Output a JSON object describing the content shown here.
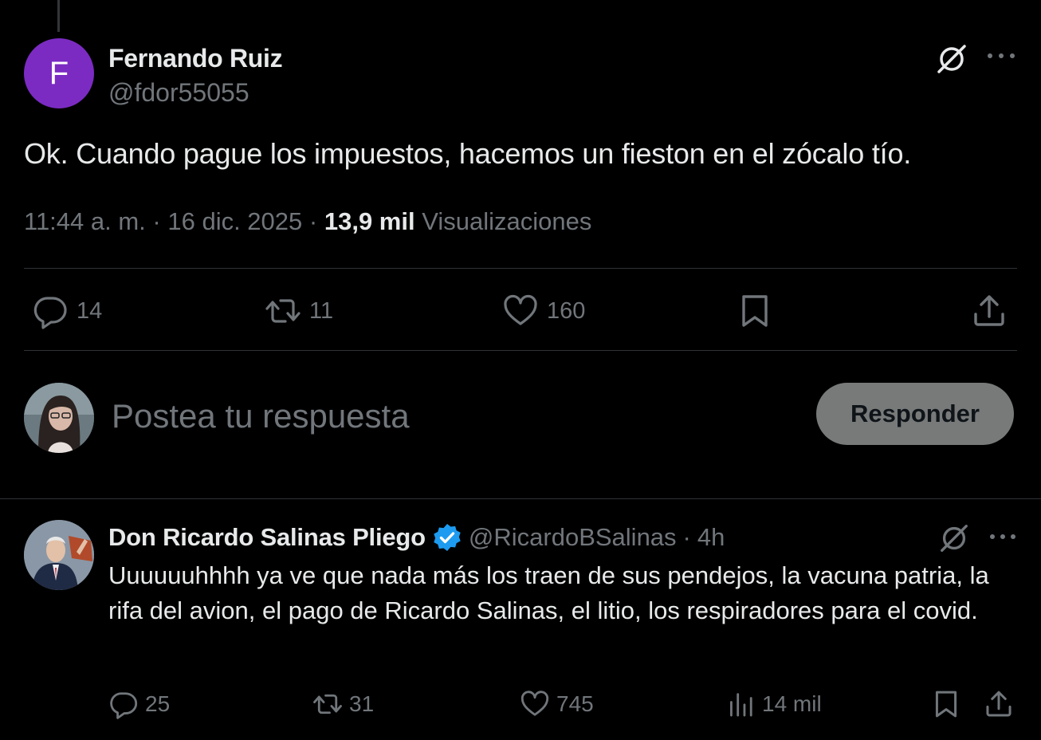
{
  "main_tweet": {
    "avatar_letter": "F",
    "avatar_color": "#7b2bc2",
    "author_name": "Fernando Ruiz",
    "author_handle": "@fdor55055",
    "text": "Ok. Cuando pague los impuestos, hacemos un fieston en el zócalo tío.",
    "time": "11:44 a. m.",
    "date": "16 dic. 2025",
    "views_count": "13,9 mil",
    "views_label": "Visualizaciones",
    "replies": "14",
    "reposts": "11",
    "likes": "160"
  },
  "reply_composer": {
    "placeholder": "Postea tu respuesta",
    "button_label": "Responder"
  },
  "reply_tweet": {
    "author_name": "Don Ricardo Salinas Pliego",
    "verified": true,
    "author_handle": "@RicardoBSalinas",
    "time": "4h",
    "text": "Uuuuuuhhhh ya ve que nada más los traen de sus pendejos, la vacuna patria, la rifa del avion, el pago de Ricardo Salinas, el litio, los respiradores para el covid.",
    "replies": "25",
    "reposts": "31",
    "likes": "745",
    "views": "14 mil"
  },
  "icons": {
    "reply": "speech-bubble-icon",
    "repost": "repost-icon",
    "like": "heart-icon",
    "bookmark": "bookmark-icon",
    "share": "share-icon",
    "views": "bar-chart-icon",
    "grok": "grok-icon",
    "more": "more-icon",
    "verified": "verified-badge-icon"
  },
  "colors": {
    "background": "#000000",
    "text_primary": "#e7e9ea",
    "text_secondary": "#71767b",
    "verified_blue": "#1d9bf0",
    "divider": "#2f3336"
  }
}
